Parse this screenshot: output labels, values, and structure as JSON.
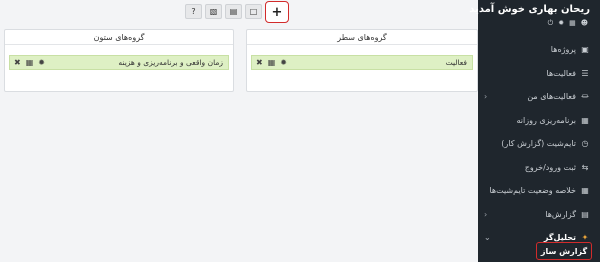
{
  "sidebar": {
    "welcome": "ریحان بهاری خوش آمدید",
    "user_icons": [
      "user-icon",
      "grid-icon",
      "gear-icon",
      "power-icon"
    ],
    "items": [
      {
        "label": "پروژه‌ها",
        "icon": "briefcase-icon"
      },
      {
        "label": "فعالیت‌ها",
        "icon": "list-icon"
      },
      {
        "label": "فعالیت‌های من",
        "icon": "microphone-icon",
        "has_children": true
      },
      {
        "label": "برنامه‌ریزی روزانه",
        "icon": "calendar-grid-icon"
      },
      {
        "label": "تایم‌شیت (گزارش کار)",
        "icon": "clock-icon"
      },
      {
        "label": "ثبت ورود/خروج",
        "icon": "swap-icon"
      },
      {
        "label": "خلاصه وضعیت تایم‌شیت‌ها",
        "icon": "table-icon"
      },
      {
        "label": "گزارش‌ها",
        "icon": "file-icon",
        "has_children": true
      },
      {
        "label": "تحلیل‌گر",
        "icon": "magic-wand-icon",
        "has_children": true,
        "active": true
      }
    ],
    "submenu_active": "گزارش ساز"
  },
  "toolbar": {
    "buttons": [
      "add-icon",
      "file-icon",
      "save-icon",
      "export-icon",
      "help-icon"
    ]
  },
  "rows_panel": {
    "title": "گروه‌های سطر",
    "items": [
      {
        "label": "فعالیت"
      }
    ]
  },
  "columns_panel": {
    "title": "گروه‌های ستون",
    "items": [
      {
        "label": "زمان واقعی و برنامه‌ریزی و هزینه"
      }
    ]
  }
}
